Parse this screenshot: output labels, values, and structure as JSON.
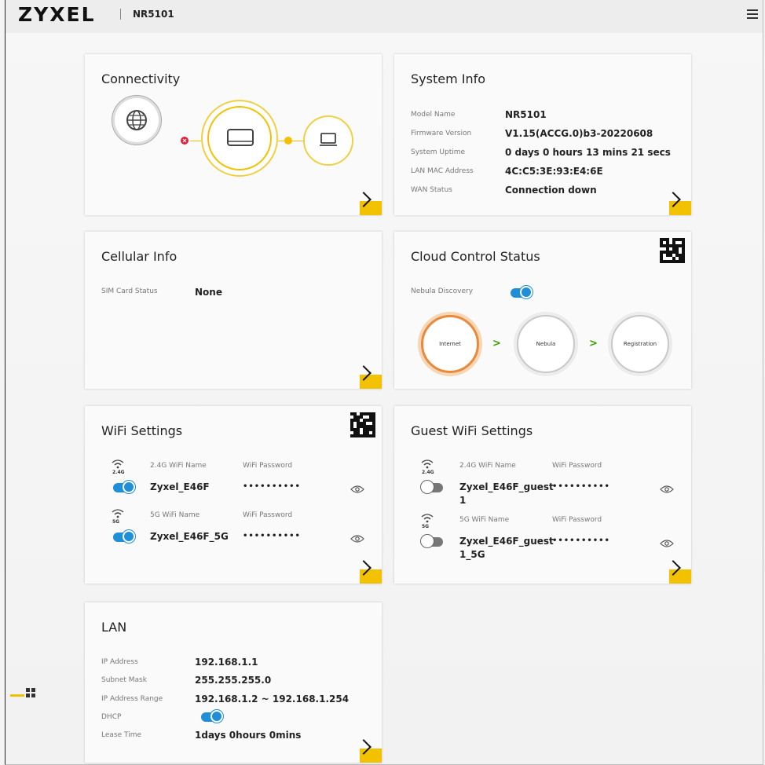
{
  "header": {
    "brand": "ZYXEL",
    "model": "NR5101"
  },
  "colors": {
    "accent": "#f2c200",
    "toggle_on": "#1e8fd8",
    "internet": "#e8893c"
  },
  "connectivity": {
    "title": "Connectivity",
    "icons": [
      "globe-icon",
      "router-icon",
      "laptop-icon"
    ]
  },
  "system_info": {
    "title": "System Info",
    "rows": [
      {
        "label": "Model Name",
        "value": "NR5101"
      },
      {
        "label": "Firmware Version",
        "value": "V1.15(ACCG.0)b3-20220608"
      },
      {
        "label": "System Uptime",
        "value": "0 days 0 hours 13 mins 21 secs"
      },
      {
        "label": "LAN MAC Address",
        "value": "4C:C5:3E:93:E4:6E"
      },
      {
        "label": "WAN Status",
        "value": "Connection down"
      }
    ]
  },
  "cellular": {
    "title": "Cellular Info",
    "sim_label": "SIM Card Status",
    "sim_value": "None"
  },
  "cloud": {
    "title": "Cloud Control Status",
    "discovery_label": "Nebula Discovery",
    "discovery_on": true,
    "steps": [
      "Internet",
      "Nebula",
      "Registration"
    ],
    "arrow": ">"
  },
  "wifi": {
    "title": "WiFi Settings",
    "bands": [
      {
        "band": "2.4G",
        "name_label": "2.4G WiFi Name",
        "pw_label": "WiFi Password",
        "name": "Zyxel_E46F",
        "password": "••••••••••",
        "enabled": true
      },
      {
        "band": "5G",
        "name_label": "5G WiFi Name",
        "pw_label": "WiFi Password",
        "name": "Zyxel_E46F_5G",
        "password": "••••••••••",
        "enabled": true
      }
    ]
  },
  "guest_wifi": {
    "title": "Guest WiFi Settings",
    "bands": [
      {
        "band": "2.4G",
        "name_label": "2.4G WiFi Name",
        "pw_label": "WiFi Password",
        "name_line1": "Zyxel_E46F_guest",
        "name_line2": "1",
        "password": "••••••••••",
        "enabled": false
      },
      {
        "band": "5G",
        "name_label": "5G WiFi Name",
        "pw_label": "WiFi Password",
        "name_line1": "Zyxel_E46F_guest",
        "name_line2": "1_5G",
        "password": "••••••••••",
        "enabled": false
      }
    ]
  },
  "lan": {
    "title": "LAN",
    "rows": [
      {
        "label": "IP Address",
        "value": "192.168.1.1"
      },
      {
        "label": "Subnet Mask",
        "value": "255.255.255.0"
      },
      {
        "label": "IP Address Range",
        "value": "192.168.1.2 ~ 192.168.1.254"
      },
      {
        "label": "DHCP",
        "value": ""
      },
      {
        "label": "Lease Time",
        "value": "1days 0hours 0mins"
      }
    ],
    "dhcp_on": true
  }
}
